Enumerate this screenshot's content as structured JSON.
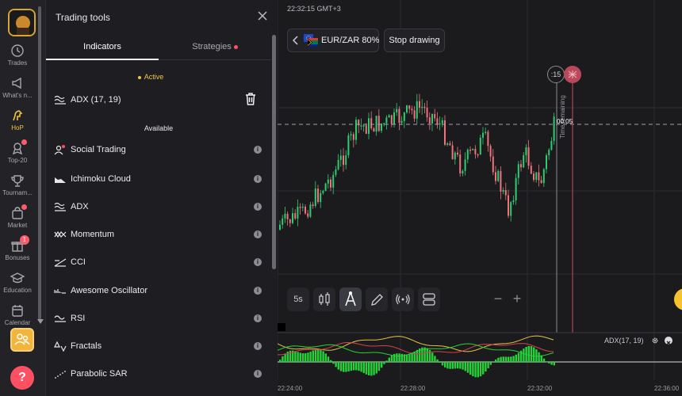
{
  "rail": {
    "items": [
      {
        "label": "Trades",
        "icon": "clock-icon",
        "badge": false,
        "active": false
      },
      {
        "label": "What's n...",
        "icon": "megaphone-icon",
        "badge": false,
        "active": false
      },
      {
        "label": "HoP",
        "icon": "horse-icon",
        "badge": false,
        "active": true
      },
      {
        "label": "Top-20",
        "icon": "award-icon",
        "badge": true,
        "active": false
      },
      {
        "label": "Tournam...",
        "icon": "trophy-icon",
        "badge": false,
        "active": false
      },
      {
        "label": "Market",
        "icon": "bag-icon",
        "badge": true,
        "active": false
      },
      {
        "label": "Bonuses",
        "icon": "gift-icon",
        "count": "1",
        "active": false
      },
      {
        "label": "Education",
        "icon": "graduation-icon",
        "badge": false,
        "active": false
      },
      {
        "label": "Calendar",
        "icon": "calendar-icon",
        "badge": false,
        "active": false
      }
    ],
    "help_label": "?"
  },
  "panel": {
    "title": "Trading tools",
    "tabs": [
      {
        "label": "Indicators",
        "active": true
      },
      {
        "label": "Strategies",
        "active": false,
        "dot": true
      }
    ],
    "active_section": "Active",
    "active_indicator": "ADX (17, 19)",
    "available_section": "Available",
    "available": [
      {
        "label": "Social Trading",
        "icon": "social-trading-icon"
      },
      {
        "label": "Ichimoku Cloud",
        "icon": "ichimoku-icon"
      },
      {
        "label": "ADX",
        "icon": "adx-icon"
      },
      {
        "label": "Momentum",
        "icon": "momentum-icon"
      },
      {
        "label": "CCI",
        "icon": "cci-icon"
      },
      {
        "label": "Awesome Oscillator",
        "icon": "awesome-oscillator-icon"
      },
      {
        "label": "RSI",
        "icon": "rsi-icon"
      },
      {
        "label": "Fractals",
        "icon": "fractals-icon"
      },
      {
        "label": "Parabolic SAR",
        "icon": "parabolic-sar-icon"
      }
    ],
    "info_glyph": "i"
  },
  "chart": {
    "clock": "22:32:15 GMT+3",
    "pair": "EUR/ZAR 80%",
    "stop_drawing": "Stop drawing",
    "timer": ":15",
    "time_remaining": "Time remaining",
    "countdown": "00:05",
    "timeframe": "5s",
    "indicator_label": "ADX(17, 19)",
    "x_ticks": [
      "22:24:00",
      "22:28:00",
      "22:32:00",
      "22:36:00"
    ],
    "colors": {
      "up": "#2ecc71",
      "down": "#f0727c",
      "accent": "#f0c440"
    }
  }
}
